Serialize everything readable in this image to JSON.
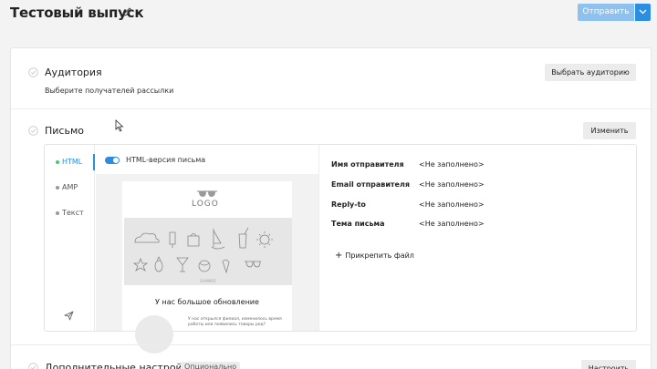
{
  "header": {
    "title": "Тестовый выпуск",
    "send_label": "Отправить",
    "accent": "#2d8de0",
    "send_disabled_color": "#8ec1ee"
  },
  "audience": {
    "title": "Аудитория",
    "subtitle": "Выберите получателей рассылки",
    "button": "Выбрать аудиторию"
  },
  "letter": {
    "title": "Письмо",
    "button": "Изменить",
    "tabs": [
      {
        "label": "HTML",
        "active": true
      },
      {
        "label": "AMP",
        "active": false
      },
      {
        "label": "Текст",
        "active": false
      }
    ],
    "toggle_label": "HTML-версия письма",
    "toggle_on": true,
    "preview": {
      "logo": "LOGO",
      "banner_sub": "SUMMER",
      "headline": "У нас большое обновление",
      "body": "У нас открылся филиал, изменилось время работы или появились товары ред?"
    },
    "fields": [
      {
        "label": "Имя отправителя",
        "value": "<Не заполнено>"
      },
      {
        "label": "Email отправителя",
        "value": "<Не заполнено>"
      },
      {
        "label": "Reply-to",
        "value": "<Не заполнено>"
      },
      {
        "label": "Тема письма",
        "value": "<Не заполнено>"
      }
    ],
    "attach_label": "Прикрепить файл"
  },
  "extra": {
    "title": "Дополнительные настройки",
    "badge": "Опционально",
    "button": "Настроить"
  },
  "icons": [
    "edit-icon",
    "chevron-down-icon",
    "check-circle-icon",
    "send-test-icon",
    "plus-icon",
    "cursor-icon"
  ]
}
